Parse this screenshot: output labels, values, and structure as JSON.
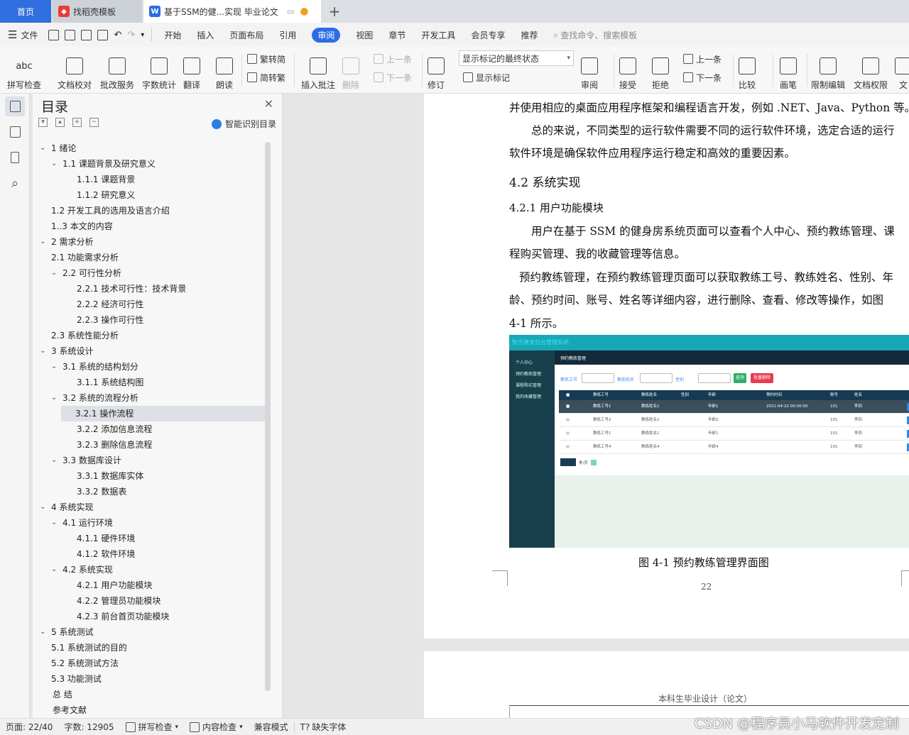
{
  "tabs": {
    "home": "首页",
    "template": "找稻壳模板",
    "doc": "基于SSM的健...实现 毕业论文"
  },
  "menu": {
    "file": "文件",
    "items": [
      "开始",
      "插入",
      "页面布局",
      "引用",
      "审阅",
      "视图",
      "章节",
      "开发工具",
      "会员专享",
      "推荐"
    ],
    "active": "审阅",
    "search": "查找命令、搜索模板"
  },
  "ribbon": {
    "spell": "拼写检查",
    "proof": "文档校对",
    "annotate": "批改服务",
    "wordcount": "字数统计",
    "translate": "翻译",
    "read": "朗读",
    "t2s": "繁转简",
    "s2t": "简转繁",
    "insert_comment": "插入批注",
    "delete": "删除",
    "prev": "上一条",
    "next": "下一条",
    "revise": "修订",
    "markup_state": "显示标记的最终状态",
    "show_markup": "显示标记",
    "review": "审阅",
    "accept": "接受",
    "reject": "拒绝",
    "prev2": "上一条",
    "next2": "下一条",
    "compare": "比较",
    "draw": "画笔",
    "restrict": "限制编辑",
    "doc_perm": "文档权限",
    "doc_more": "文"
  },
  "toc": {
    "title": "目录",
    "smart": "智能识别目录",
    "items": [
      {
        "t": "1  绪论",
        "l": 0,
        "c": true
      },
      {
        "t": "1.1  课题背景及研究意义",
        "l": 1,
        "c": true
      },
      {
        "t": "1.1.1  课题背景",
        "l": 2
      },
      {
        "t": "1.1.2  研究意义",
        "l": 2
      },
      {
        "t": "1.2  开发工具的选用及语言介绍",
        "l": 1
      },
      {
        "t": "1..3 本文的内容",
        "l": 1
      },
      {
        "t": "2  需求分析",
        "l": 0,
        "c": true
      },
      {
        "t": "2.1  功能需求分析",
        "l": 1
      },
      {
        "t": "2.2  可行性分析",
        "l": 1,
        "c": true
      },
      {
        "t": "2.2.1 技术可行性：技术背景",
        "l": 2
      },
      {
        "t": "2.2.2 经济可行性",
        "l": 2
      },
      {
        "t": "2.2.3 操作可行性",
        "l": 2
      },
      {
        "t": "2.3 系统性能分析",
        "l": 1
      },
      {
        "t": "3  系统设计",
        "l": 0,
        "c": true
      },
      {
        "t": "3.1  系统的结构划分",
        "l": 1,
        "c": true
      },
      {
        "t": "3.1.1  系统结构图",
        "l": 2
      },
      {
        "t": "3.2  系统的流程分析",
        "l": 1,
        "c": true
      },
      {
        "t": "3.2.1 操作流程",
        "l": 2,
        "sel": true
      },
      {
        "t": "3.2.2 添加信息流程",
        "l": 2
      },
      {
        "t": "3.2.3 删除信息流程",
        "l": 2
      },
      {
        "t": "3.3 数据库设计",
        "l": 1,
        "c": true
      },
      {
        "t": "3.3.1  数据库实体",
        "l": 2
      },
      {
        "t": "3.3.2 数据表",
        "l": 2
      },
      {
        "t": "4  系统实现",
        "l": 0,
        "c": true
      },
      {
        "t": "4.1  运行环境",
        "l": 1,
        "c": true
      },
      {
        "t": "4.1.1  硬件环境",
        "l": 2
      },
      {
        "t": "4.1.2  软件环境",
        "l": 2
      },
      {
        "t": "4.2  系统实现",
        "l": 1,
        "c": true
      },
      {
        "t": "4.2.1 用户功能模块",
        "l": 2
      },
      {
        "t": "4.2.2 管理员功能模块",
        "l": 2
      },
      {
        "t": "4.2.3 前台首页功能模块",
        "l": 2
      },
      {
        "t": "5  系统测试",
        "l": 0,
        "c": true
      },
      {
        "t": "5.1 系统测试的目的",
        "l": 1
      },
      {
        "t": "5.2 系统测试方法",
        "l": 1
      },
      {
        "t": "5.3 功能测试",
        "l": 1
      },
      {
        "t": "总    结",
        "l": -1
      },
      {
        "t": "参考文献",
        "l": -1
      }
    ]
  },
  "page": {
    "lines": [
      "并使用相应的桌面应用程序框架和编程语言开发，例如 .NET、Java、Python 等。",
      "总的来说，不同类型的运行软件需要不同的运行软件环境，选定合适的运行",
      "软件环境是确保软件应用程序运行稳定和高效的重要因素。"
    ],
    "h2": "4.2  系统实现",
    "h3": "4.2.1 用户功能模块",
    "para2": [
      "用户在基于 SSM 的健身房系统页面可以查看个人中心、预约教练管理、课",
      "程购买管理、我的收藏管理等信息。"
    ],
    "para3": [
      "预约教练管理，在预约教练管理页面可以获取教练工号、教练姓名、性别、年",
      "龄、预约时间、账号、姓名等详细内容，进行删除、查看、修改等操作，如图",
      "4-1 所示。"
    ],
    "caption": "图 4-1 预约教练管理界面图",
    "page_number": "22",
    "next_header": "本科生毕业设计（论文）"
  },
  "shot": {
    "top_title": "智乐健身后台管理系统",
    "side": [
      "个人中心",
      "预约教练管理",
      "课程购买管理",
      "我的收藏管理"
    ],
    "head": "预约教练管理",
    "labels": [
      "教练工号",
      "教练姓名",
      "性别"
    ],
    "search_btn": "查询",
    "del_btn": "批量删除",
    "cols": [
      "教练工号",
      "教练姓名",
      "性别",
      "年龄",
      "预约时间",
      "账号",
      "姓名"
    ],
    "rows": [
      [
        "教练工号1",
        "教练姓名1",
        "",
        "年龄1",
        "2021-04-22 00:00:00",
        "101",
        "李四"
      ],
      [
        "教练工号2",
        "教练姓名2",
        "",
        "年龄2",
        "",
        "101",
        "李四"
      ],
      [
        "教练工号1",
        "教练姓名1",
        "",
        "年龄1",
        "",
        "101",
        "李四"
      ],
      [
        "教练工号4",
        "教练姓名4",
        "",
        "年龄4",
        "",
        "101",
        "李四"
      ]
    ],
    "pager_text": "条/页"
  },
  "status": {
    "page": "页面: 22/40",
    "words": "字数: 12905",
    "spell": "拼写检查",
    "content": "内容检查",
    "compat": "兼容模式",
    "missing_font": "缺失字体"
  },
  "watermark": "CSDN @程序员小马软件开发定制",
  "colors": {
    "accent": "#2b6de4",
    "home_tab": "#2f6fdf",
    "shot_top": "#18a7b5",
    "shot_side": "#173f4c"
  }
}
